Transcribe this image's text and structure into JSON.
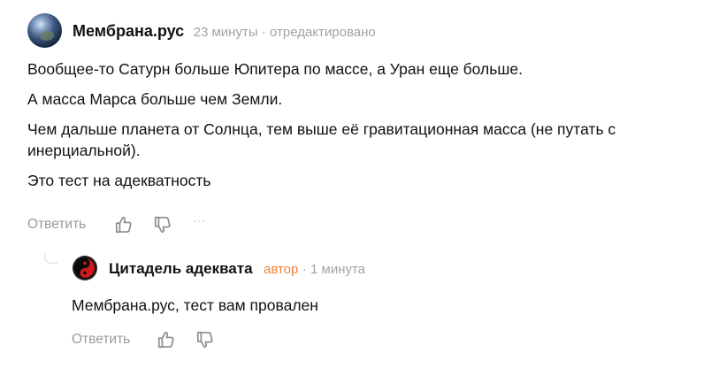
{
  "comment": {
    "author": "Мембрана.рус",
    "time": "23 минуты",
    "separator": "·",
    "edited": "отредактировано",
    "paragraphs": [
      "Вообщее-то Сатурн больше Юпитера по массе, а Уран еще больше.",
      "А масса Марса больше чем Земли.",
      "Чем дальше планета от Солнца, тем выше её гравитационная масса (не путать с инерциальной).",
      "Это тест на адекватность"
    ],
    "actions": {
      "reply_label": "Ответить",
      "like_icon": "thumbs-up-icon",
      "dislike_icon": "thumbs-down-icon",
      "more_icon": "more-dots-icon",
      "more_glyph": "···"
    }
  },
  "reply": {
    "author": "Цитадель адеквата",
    "badge": "автор",
    "separator": "·",
    "time": "1 минута",
    "text": "Мембрана.рус, тест вам провален",
    "actions": {
      "reply_label": "Ответить",
      "like_icon": "thumbs-up-icon",
      "dislike_icon": "thumbs-down-icon"
    }
  },
  "colors": {
    "meta_text": "#a3a3a3",
    "author_badge": "#f0813b",
    "action_text": "#9a9a9a",
    "avatar_reply_accent": "#d11a1a"
  }
}
